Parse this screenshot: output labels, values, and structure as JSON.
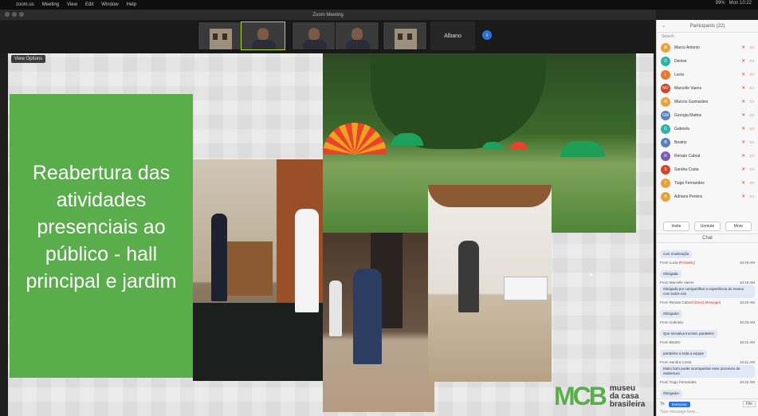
{
  "menubar": {
    "apple": "",
    "items": [
      "zoom.us",
      "Meeting",
      "View",
      "Edit",
      "Window",
      "Help"
    ],
    "right": [
      "Mon 10:22",
      "99%"
    ]
  },
  "window": {
    "title": "Zoom Meeting"
  },
  "video_strip": {
    "name_label": "Albano"
  },
  "share": {
    "view_options": "View Options"
  },
  "slide": {
    "title": "Reabertura das atividades presenciais ao público  - hall principal e jardim",
    "logo_mark": "MCB",
    "logo_words": [
      "museu",
      "da casa",
      "brasileira"
    ]
  },
  "participants_panel": {
    "title": "Participants (22)",
    "search": "Search",
    "items": [
      {
        "initials": "M",
        "name": "Marco Antonio",
        "color": "#e8a23b"
      },
      {
        "initials": "D",
        "name": "Denise",
        "color": "#2fb3a8"
      },
      {
        "initials": "L",
        "name": "Lucia",
        "color": "#e87a2b"
      },
      {
        "initials": "MV",
        "name": "Marcelle Vaens",
        "color": "#d0452c"
      },
      {
        "initials": "M",
        "name": "Marcos Guimarães",
        "color": "#e8a23b"
      },
      {
        "initials": "GM",
        "name": "Georgia Mattos",
        "color": "#5a7fbf"
      },
      {
        "initials": "G",
        "name": "Gabriela",
        "color": "#2fb3a8"
      },
      {
        "initials": "B",
        "name": "Beatriz",
        "color": "#5a7fbf"
      },
      {
        "initials": "R",
        "name": "Renato Cabral",
        "color": "#7a5ab5"
      },
      {
        "initials": "S",
        "name": "Sandra Costa",
        "color": "#d0452c"
      },
      {
        "initials": "T",
        "name": "Tiago Fernandes",
        "color": "#e8a23b"
      },
      {
        "initials": "A",
        "name": "Adriana Pereira",
        "color": "#e8a23b"
      }
    ],
    "buttons": [
      "Invite",
      "Unmute",
      "More"
    ]
  },
  "chat": {
    "title": "Chat",
    "messages": [
      {
        "from": "",
        "time": "",
        "private": "",
        "text": "com moderação"
      },
      {
        "from": "From Lucia",
        "time": "10:19 AM",
        "private": "(Privately)",
        "text": "Obrigada"
      },
      {
        "from": "From Marcelle Vaens",
        "time": "10:19 AM",
        "private": "",
        "text": "Obrigada por compartilhar a experiência do museu com todos nós"
      },
      {
        "from": "From Renato Cabral",
        "time": "10:20 AM",
        "private": "(Direct Message)",
        "text": "Obrigado!"
      },
      {
        "from": "From Gabriela",
        "time": "10:20 AM",
        "private": "",
        "text": "Que iniciativa incrível, parabéns"
      },
      {
        "from": "From Beatriz",
        "time": "10:21 AM",
        "private": "",
        "text": "parabéns a toda a equipe"
      },
      {
        "from": "From Sandra Costa",
        "time": "10:21 AM",
        "private": "",
        "text": "Muito bom poder acompanhar esse processo de reabertura"
      },
      {
        "from": "From Tiago Fernandes",
        "time": "10:22 AM",
        "private": "",
        "text": "Obrigado!"
      }
    ],
    "to_label": "To:",
    "to_value": "Everyone",
    "file_label": "File",
    "placeholder": "Type message here..."
  }
}
